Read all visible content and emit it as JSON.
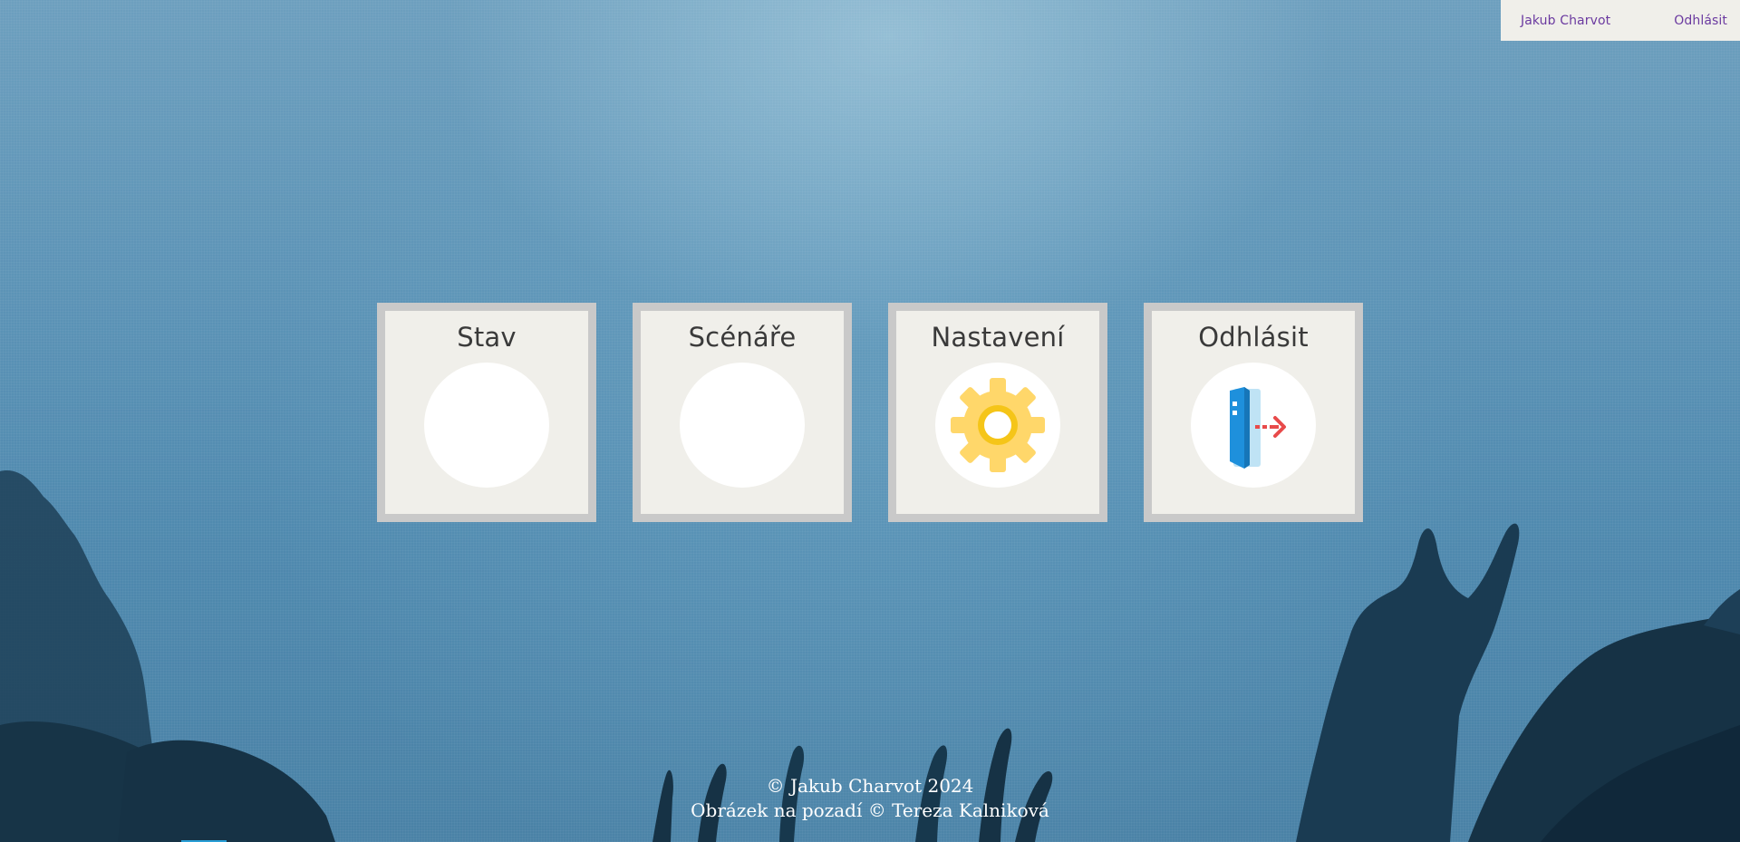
{
  "nav": {
    "user_name": "Jakub Charvot",
    "logout_label": "Odhlásit"
  },
  "tiles": [
    {
      "title": "Stav",
      "icon": "blank-circle-icon"
    },
    {
      "title": "Scénáře",
      "icon": "blank-circle-icon"
    },
    {
      "title": "Nastavení",
      "icon": "gear-icon"
    },
    {
      "title": "Odhlásit",
      "icon": "logout-door-icon"
    }
  ],
  "footer": {
    "copyright": "© Jakub Charvot 2024",
    "background_credit": "Obrázek na pozadí © Tereza Kalniková"
  },
  "colors": {
    "nav_background": "#f0efea",
    "nav_text": "#6b3aa0",
    "tile_background": "#f0efea",
    "tile_border": "#c9c9c9",
    "gear": "#ffd76a",
    "door": "#1e90dc",
    "arrow": "#e84a4a"
  }
}
